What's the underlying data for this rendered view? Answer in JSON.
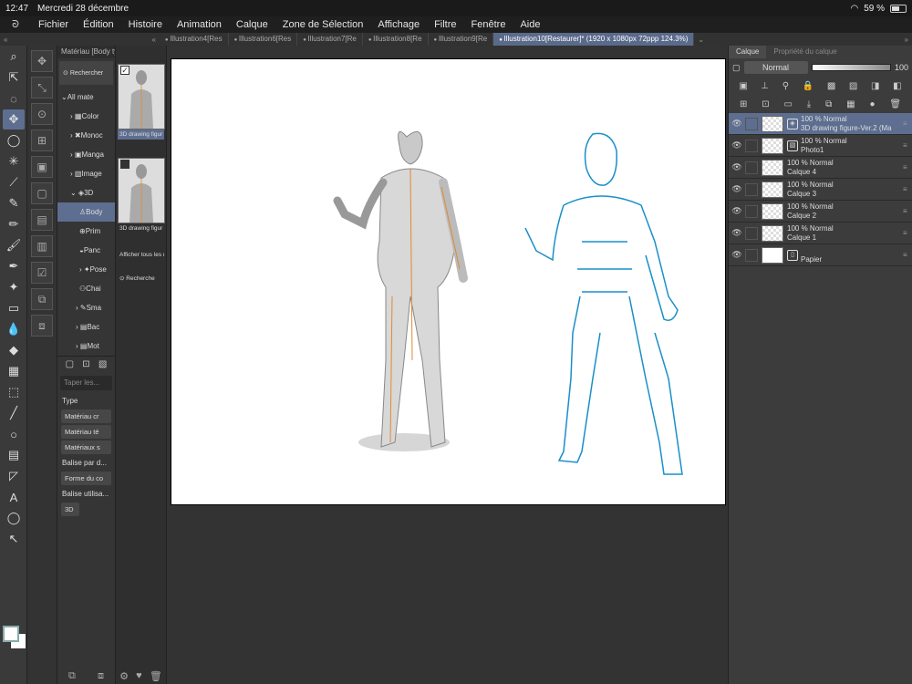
{
  "status": {
    "time": "12:47",
    "date": "Mercredi 28 décembre",
    "battery": "59 %",
    "battery_level": 0.59
  },
  "menu": [
    "Fichier",
    "Édition",
    "Histoire",
    "Animation",
    "Calque",
    "Zone de Sélection",
    "Affichage",
    "Filtre",
    "Fenêtre",
    "Aide"
  ],
  "tabs": [
    {
      "label": "Illustration4[Res"
    },
    {
      "label": "Illustration6[Res"
    },
    {
      "label": "Illustration7[Re"
    },
    {
      "label": "Illustration8[Re"
    },
    {
      "label": "Illustration9[Re"
    },
    {
      "label": "Illustration10[Restaurer]* (1920 x 1080px 72ppp 124.3%)"
    }
  ],
  "material": {
    "header": "Matériau [Body type]",
    "search_button": "Rechercher",
    "tree": [
      "All mate",
      "Color",
      "Monoc",
      "Manga",
      "Image",
      "3D",
      "Body",
      "Prim",
      "Panc",
      "Pose",
      "Chai",
      "Sma",
      "Bac",
      "Mot"
    ],
    "search_placeholder": "Taper les...",
    "type_label": "Type",
    "type_chips": [
      "Matériau cr",
      "Matériau té",
      "Matériaux s"
    ],
    "tag_label": "Balise par d...",
    "tag_chip": "Forme du co",
    "used_label": "Balise utilisa...",
    "used_chip": "3D"
  },
  "thumbs": {
    "item1": "3D drawing figur",
    "item2": "3D drawing figur",
    "show_all": "Afficher tous les ma",
    "search": "Recherche"
  },
  "layers": {
    "tab1": "Calque",
    "tab2": "Propriété du calque",
    "blend": "Normal",
    "opacity": "100",
    "items": [
      {
        "opacity": "100 %",
        "mode": "Normal",
        "name": "3D drawing figure-Ver.2 (Ma",
        "type": "3d"
      },
      {
        "opacity": "100 %",
        "mode": "Normal",
        "name": "Photo1",
        "type": "img"
      },
      {
        "opacity": "100 %",
        "mode": "Normal",
        "name": "Calque 4",
        "type": "raster"
      },
      {
        "opacity": "100 %",
        "mode": "Normal",
        "name": "Calque 3",
        "type": "raster"
      },
      {
        "opacity": "100 %",
        "mode": "Normal",
        "name": "Calque 2",
        "type": "raster"
      },
      {
        "opacity": "100 %",
        "mode": "Normal",
        "name": "Calque 1",
        "type": "raster"
      },
      {
        "opacity": "",
        "mode": "",
        "name": "Papier",
        "type": "paper"
      }
    ]
  },
  "colors": {
    "accent": "#5d6e90",
    "sketch": "#1a8fc8",
    "guide": "#e08a30"
  }
}
